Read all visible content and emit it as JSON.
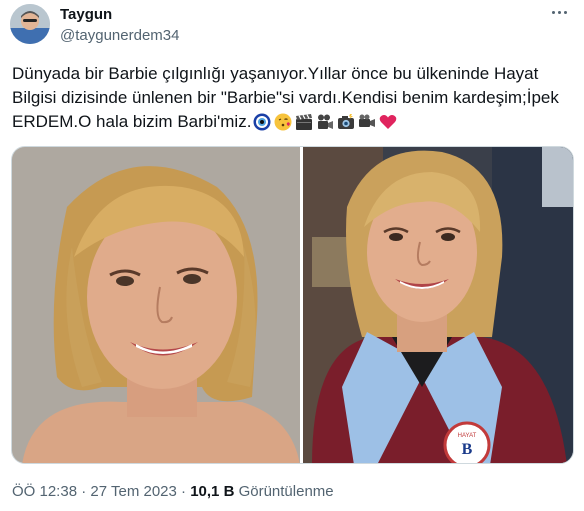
{
  "author": {
    "display_name": "Taygun",
    "handle": "@taygunerdem34"
  },
  "tweet": {
    "text": "Dünyada bir Barbie çılgınlığı yaşanıyor.Yıllar önce bu ülkeninde Hayat Bilgisi dizisinde ünlenen bir \"Barbie\"si vardı.Kendisi benim kardeşim;İpek ERDEM.O hala bizim Barbi'miz.",
    "emojis": [
      "nazar-icon",
      "kiss-face-icon",
      "clapper-board-icon",
      "film-camera-icon",
      "camera-flash-icon",
      "movie-camera-icon",
      "red-heart-icon"
    ]
  },
  "media": {
    "badge_text": "HAYAT",
    "badge_letter": "B"
  },
  "meta": {
    "time": "ÖÖ 12:38",
    "separator1": "·",
    "date": "27 Tem 2023",
    "separator2": "·",
    "views_count": "10,1 B",
    "views_label": "Görüntülenme"
  },
  "colors": {
    "text_primary": "#0f1419",
    "text_secondary": "#536471",
    "border": "#cfd9de"
  }
}
